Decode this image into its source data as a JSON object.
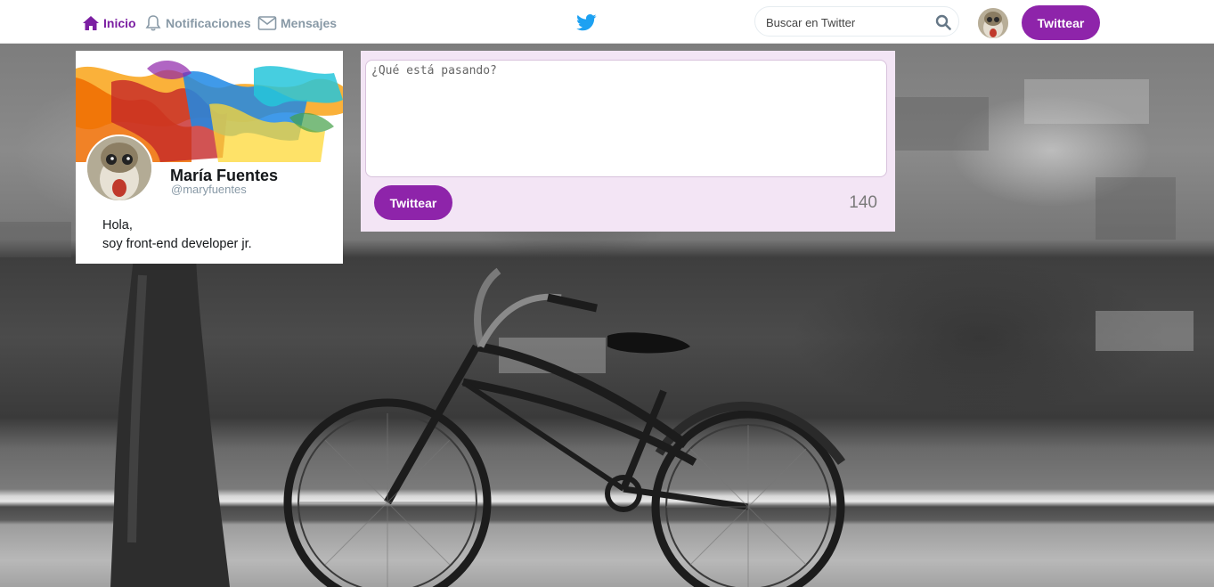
{
  "nav": {
    "items": [
      {
        "label": "Inicio",
        "icon": "home-icon",
        "active": true
      },
      {
        "label": "Notificaciones",
        "icon": "bell-icon",
        "active": false
      },
      {
        "label": "Mensajes",
        "icon": "envelope-icon",
        "active": false
      }
    ],
    "logo": "twitter-bird-icon",
    "search": {
      "placeholder": "Buscar en Twitter",
      "value": ""
    },
    "tweet_button": "Twittear"
  },
  "profile": {
    "name": "María Fuentes",
    "handle": "@maryfuentes",
    "bio_line1": "Hola,",
    "bio_line2": "soy front-end developer jr."
  },
  "compose": {
    "placeholder": "¿Qué está pasando?",
    "value": "",
    "tweet_button": "Twittear",
    "char_count": "140"
  },
  "colors": {
    "accent": "#8e24aa",
    "active_nav": "#7b1fa2",
    "compose_bg": "#f3e5f5",
    "twitter_blue": "#1da1f2",
    "muted": "#8899a6"
  }
}
